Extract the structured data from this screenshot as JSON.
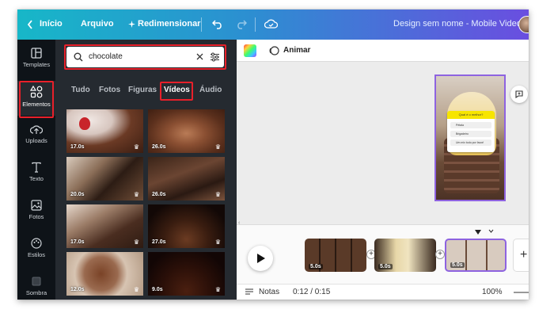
{
  "topbar": {
    "home_label": "Início",
    "file_label": "Arquivo",
    "resize_label": "Redimensionar",
    "design_title": "Design sem nome - Mobile Video"
  },
  "sidebar": {
    "items": [
      {
        "label": "Templates",
        "icon": "templates-icon"
      },
      {
        "label": "Elementos",
        "icon": "elements-icon"
      },
      {
        "label": "Uploads",
        "icon": "upload-icon"
      },
      {
        "label": "Texto",
        "icon": "text-icon"
      },
      {
        "label": "Fotos",
        "icon": "photos-icon"
      },
      {
        "label": "Estilos",
        "icon": "styles-icon"
      },
      {
        "label": "Sombra",
        "icon": "shadow-icon"
      }
    ],
    "active": "Elementos"
  },
  "panel": {
    "search": {
      "value": "chocolate"
    },
    "tabs": [
      "Tudo",
      "Fotos",
      "Figuras",
      "Vídeos",
      "Áudio"
    ],
    "active_tab": "Vídeos",
    "videos": [
      {
        "duration": "17.0s"
      },
      {
        "duration": "26.0s"
      },
      {
        "duration": "20.0s"
      },
      {
        "duration": "26.0s"
      },
      {
        "duration": "17.0s"
      },
      {
        "duration": "27.0s"
      },
      {
        "duration": "12.0s"
      },
      {
        "duration": "9.0s"
      }
    ]
  },
  "editor": {
    "animate_label": "Animar",
    "artboard": {
      "poll_title": "Qual é o melhor?",
      "options": [
        "Pétala",
        "Brigadeiro",
        "Um mix todo por favor!"
      ]
    }
  },
  "timeline": {
    "clips": [
      {
        "duration": "5.0s"
      },
      {
        "duration": "5.0s"
      },
      {
        "duration": "5.0s"
      }
    ]
  },
  "bottombar": {
    "notes_label": "Notas",
    "time": "0:12 / 0:15",
    "zoom": "100%"
  },
  "colors": {
    "highlight": "#e8202a",
    "selection": "#8e63e0",
    "panel_bg": "#252a30",
    "sidebar_bg": "#0e1318"
  }
}
